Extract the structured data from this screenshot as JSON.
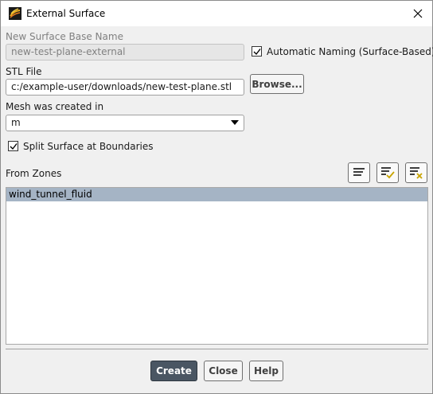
{
  "window": {
    "title": "External Surface"
  },
  "form": {
    "base_name_label": "New Surface Base Name",
    "base_name_value": "new-test-plane-external",
    "auto_naming_label": "Automatic Naming (Surface-Based)",
    "auto_naming_checked": true,
    "stl_label": "STL File",
    "stl_value": "c:/example-user/downloads/new-test-plane.stl",
    "browse_label": "Browse...",
    "mesh_unit_label": "Mesh was created in",
    "mesh_unit_value": "m",
    "split_label": "Split Surface at Boundaries",
    "split_checked": true,
    "zones_label": "From Zones",
    "zones": [
      "wind_tunnel_fluid"
    ]
  },
  "footer": {
    "create_label": "Create",
    "close_label": "Close",
    "help_label": "Help"
  },
  "colors": {
    "selection": "#a5b4c5",
    "primary_button": "#4a5663"
  },
  "icons": {
    "app": "fluent-app-icon",
    "close": "close-icon",
    "zone_tools": [
      "select-all-icon",
      "select-check-icon",
      "deselect-all-icon"
    ]
  }
}
